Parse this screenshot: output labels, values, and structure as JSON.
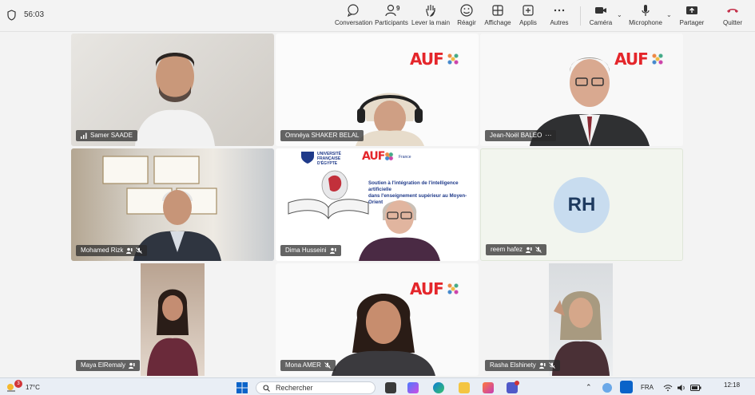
{
  "toolbar": {
    "timer": "56:03",
    "buttons": [
      {
        "key": "conversation",
        "label": "Conversation"
      },
      {
        "key": "participants",
        "label": "Participants",
        "count": "9"
      },
      {
        "key": "raise",
        "label": "Lever la main"
      },
      {
        "key": "react",
        "label": "Réagir"
      },
      {
        "key": "view",
        "label": "Affichage"
      },
      {
        "key": "apps",
        "label": "Applis"
      },
      {
        "key": "more",
        "label": "Autres"
      },
      {
        "key": "camera",
        "label": "Caméra"
      },
      {
        "key": "mic",
        "label": "Microphone"
      },
      {
        "key": "share",
        "label": "Partager"
      },
      {
        "key": "leave",
        "label": "Quitter"
      }
    ]
  },
  "participants": [
    {
      "name": "Samer SAADE"
    },
    {
      "name": "Omnéya SHAKER BELAL"
    },
    {
      "name": "Jean-Noël BALEO"
    },
    {
      "name": "Mohamed Rizk"
    },
    {
      "name": "Dima Husseini"
    },
    {
      "name": "reem hafez",
      "initials": "RH"
    },
    {
      "name": "Maya ElRemaly"
    },
    {
      "name": "Mona AMER"
    },
    {
      "name": "Rasha Elshinety"
    }
  ],
  "slide": {
    "university": "UNIVERSITÉ FRANÇAISE D'ÉGYPTE",
    "logo": "AUF",
    "country": "France",
    "title_line1": "Soutien à l'intégration de l'intelligence artificielle",
    "title_line2": "dans l'enseignement supérieur au Moyen-Orient"
  },
  "logo_text": "AUF",
  "taskbar": {
    "weather_badge": "3",
    "temperature": "17°C",
    "search_placeholder": "Rechercher",
    "lang": "FRA",
    "time": "12:18"
  },
  "colors": {
    "leave": "#c4314b",
    "accent": "#e4262b"
  }
}
